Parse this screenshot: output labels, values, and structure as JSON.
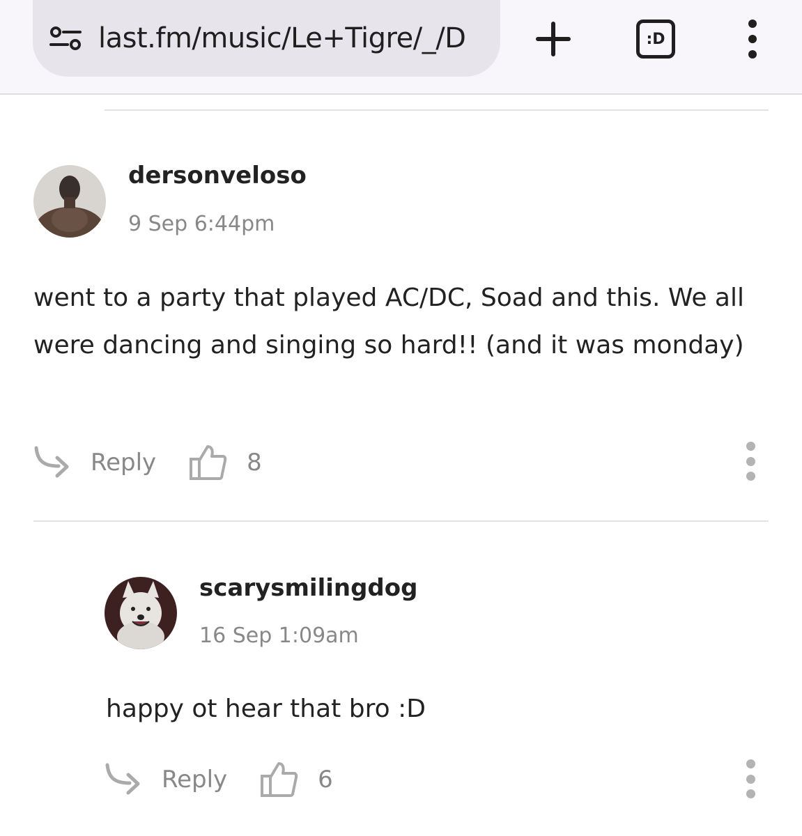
{
  "browser": {
    "url": "last.fm/music/Le+Tigre/_/D",
    "site_icon": "site-settings-icon",
    "new_tab_icon": "plus-icon",
    "tabs_label": ":D",
    "menu_icon": "more-vert-icon"
  },
  "comments": [
    {
      "username": "dersonveloso",
      "timestamp": "9 Sep 6:44pm",
      "text": "went to a party that played AC/DC, Soad and this. We all were dancing and singing so hard!! (and it was monday)",
      "reply_label": "Reply",
      "likes": "8"
    },
    {
      "username": "scarysmilingdog",
      "timestamp": "16 Sep 1:09am",
      "text": "happy ot hear that bro :D",
      "reply_label": "Reply",
      "likes": "6"
    }
  ],
  "colors": {
    "text": "#222222",
    "muted": "#888888",
    "divider": "#e2e2e2",
    "toolbar": "#f8f6fb",
    "urlbar": "#e7e4ec"
  }
}
